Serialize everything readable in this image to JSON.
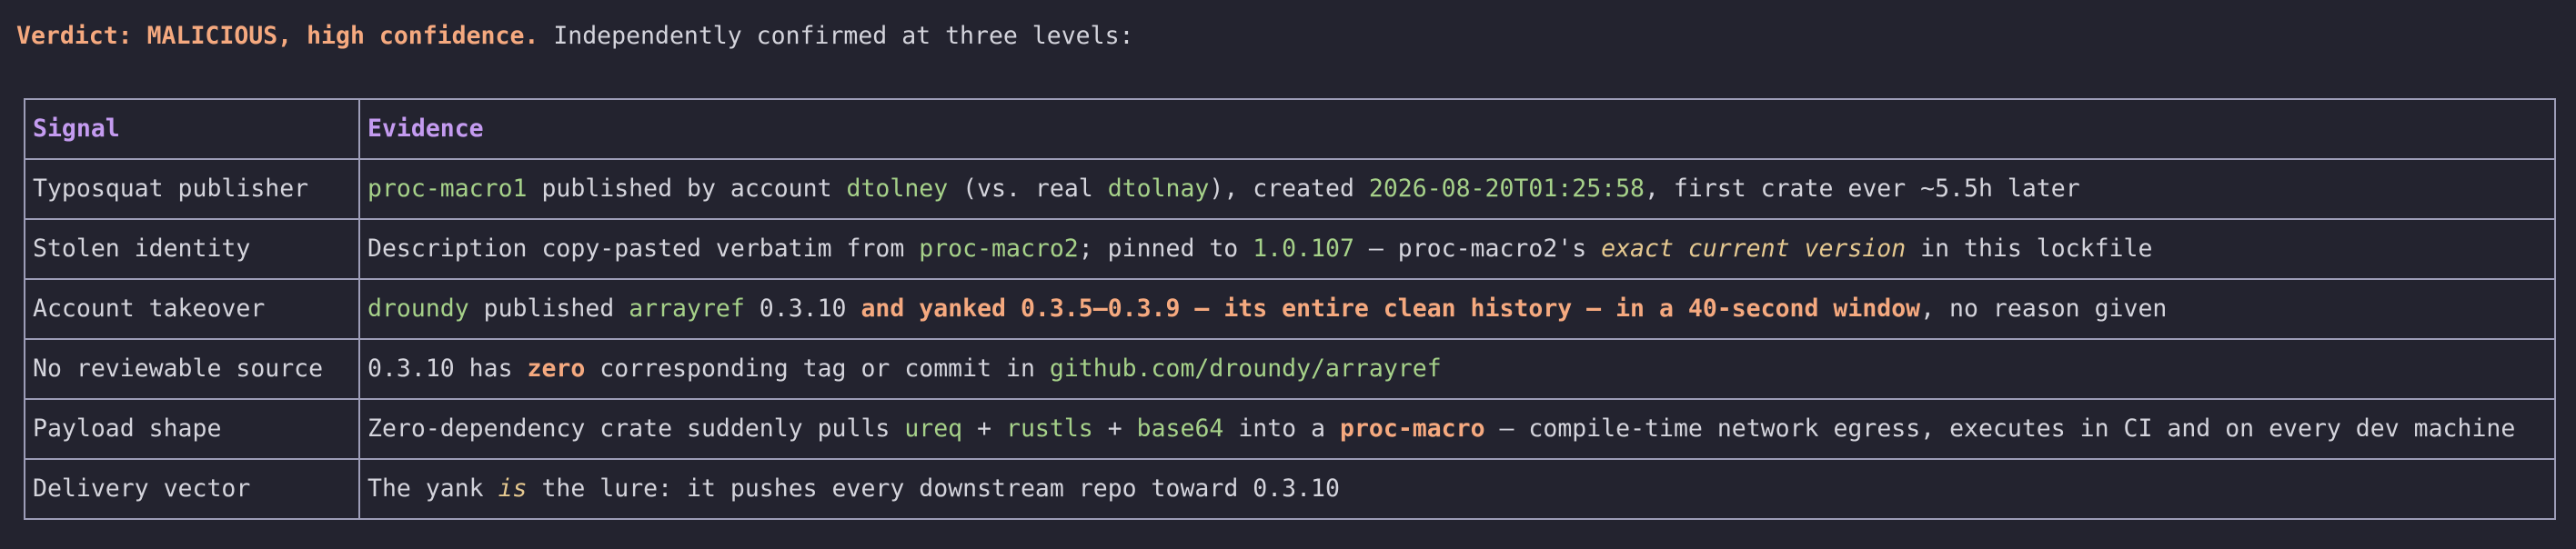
{
  "verdict": {
    "label": "Verdict: MALICIOUS, high confidence.",
    "text": " Independently confirmed at three levels:"
  },
  "table": {
    "headers": [
      "Signal",
      "Evidence"
    ],
    "rows": [
      {
        "signal": "Typosquat publisher",
        "evidence": [
          {
            "t": "proc-macro1",
            "s": "g"
          },
          {
            "t": " published by account ",
            "s": ""
          },
          {
            "t": "dtolney",
            "s": "g"
          },
          {
            "t": " (vs. real ",
            "s": ""
          },
          {
            "t": "dtolnay",
            "s": "g"
          },
          {
            "t": "), created ",
            "s": ""
          },
          {
            "t": "2026-08-20T01:25:58",
            "s": "g"
          },
          {
            "t": ", first crate ever ~5.5h later",
            "s": ""
          }
        ]
      },
      {
        "signal": "Stolen identity",
        "evidence": [
          {
            "t": "Description copy-pasted verbatim from ",
            "s": ""
          },
          {
            "t": "proc-macro2",
            "s": "g"
          },
          {
            "t": "; pinned to ",
            "s": ""
          },
          {
            "t": "1.0.107",
            "s": "g"
          },
          {
            "t": " — proc-macro2's ",
            "s": ""
          },
          {
            "t": "exact current version",
            "s": "y"
          },
          {
            "t": " in this lockfile",
            "s": ""
          }
        ]
      },
      {
        "signal": "Account takeover",
        "evidence": [
          {
            "t": "droundy",
            "s": "g"
          },
          {
            "t": " published ",
            "s": ""
          },
          {
            "t": "arrayref",
            "s": "g"
          },
          {
            "t": " 0.3.10 ",
            "s": ""
          },
          {
            "t": "and yanked 0.3.5–0.3.9 — its entire clean history — in a 40-second window",
            "s": "o"
          },
          {
            "t": ", no reason given",
            "s": ""
          }
        ]
      },
      {
        "signal": "No reviewable source",
        "evidence": [
          {
            "t": "0.3.10 has ",
            "s": ""
          },
          {
            "t": "zero",
            "s": "o"
          },
          {
            "t": " corresponding tag or commit in ",
            "s": ""
          },
          {
            "t": "github.com/droundy/arrayref",
            "s": "g"
          }
        ]
      },
      {
        "signal": "Payload shape",
        "evidence": [
          {
            "t": "Zero-dependency crate suddenly pulls ",
            "s": ""
          },
          {
            "t": "ureq",
            "s": "g"
          },
          {
            "t": " + ",
            "s": ""
          },
          {
            "t": "rustls",
            "s": "g"
          },
          {
            "t": " + ",
            "s": ""
          },
          {
            "t": "base64",
            "s": "g"
          },
          {
            "t": " into a ",
            "s": ""
          },
          {
            "t": "proc-macro",
            "s": "o"
          },
          {
            "t": " — compile-time network egress, executes in CI and on every dev machine",
            "s": ""
          }
        ]
      },
      {
        "signal": "Delivery vector",
        "evidence": [
          {
            "t": "The yank ",
            "s": ""
          },
          {
            "t": "is",
            "s": "y"
          },
          {
            "t": " the lure: it pushes every downstream repo toward 0.3.10",
            "s": ""
          }
        ]
      }
    ]
  },
  "colors": {
    "background": "#23232f",
    "text": "#d4d4dc",
    "header": "#c49bf0",
    "code_green": "#a6d189",
    "emphasis_orange": "#f5a97f",
    "italic_yellow": "#e5c890",
    "border": "#9d9db8"
  }
}
